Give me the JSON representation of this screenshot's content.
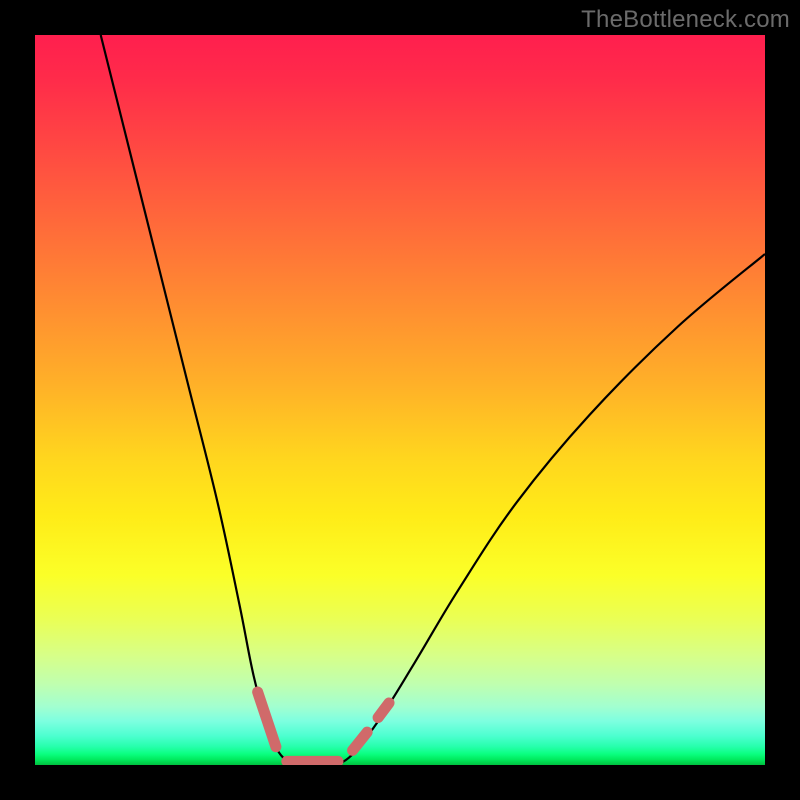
{
  "watermark": "TheBottleneck.com",
  "chart_data": {
    "type": "line",
    "title": "",
    "xlabel": "",
    "ylabel": "",
    "xlim": [
      0,
      100
    ],
    "ylim": [
      0,
      100
    ],
    "background_gradient": {
      "direction": "vertical",
      "stops": [
        {
          "pos": 0,
          "color": "#ff1f4e"
        },
        {
          "pos": 50,
          "color": "#ffd61e"
        },
        {
          "pos": 80,
          "color": "#eaff55"
        },
        {
          "pos": 100,
          "color": "#00c040"
        }
      ]
    },
    "series": [
      {
        "name": "bottleneck-curve",
        "color": "#000000",
        "points": [
          {
            "x": 9,
            "y": 100
          },
          {
            "x": 13,
            "y": 84
          },
          {
            "x": 17,
            "y": 68
          },
          {
            "x": 21,
            "y": 52
          },
          {
            "x": 25,
            "y": 36
          },
          {
            "x": 28,
            "y": 22
          },
          {
            "x": 30,
            "y": 12
          },
          {
            "x": 32,
            "y": 5
          },
          {
            "x": 34,
            "y": 1
          },
          {
            "x": 37,
            "y": 0
          },
          {
            "x": 40,
            "y": 0
          },
          {
            "x": 43,
            "y": 1
          },
          {
            "x": 47,
            "y": 6
          },
          {
            "x": 52,
            "y": 14
          },
          {
            "x": 58,
            "y": 24
          },
          {
            "x": 66,
            "y": 36
          },
          {
            "x": 76,
            "y": 48
          },
          {
            "x": 88,
            "y": 60
          },
          {
            "x": 100,
            "y": 70
          }
        ]
      }
    ],
    "markers": [
      {
        "name": "left-descent-marker",
        "x1": 30.5,
        "y1": 10,
        "x2": 33,
        "y2": 2.5
      },
      {
        "name": "valley-floor-marker",
        "x1": 34.5,
        "y1": 0.5,
        "x2": 41.5,
        "y2": 0.5
      },
      {
        "name": "right-ascent-marker-1",
        "x1": 43.5,
        "y1": 2,
        "x2": 45.5,
        "y2": 4.5
      },
      {
        "name": "right-ascent-marker-2",
        "x1": 47,
        "y1": 6.5,
        "x2": 48.5,
        "y2": 8.5
      }
    ]
  }
}
